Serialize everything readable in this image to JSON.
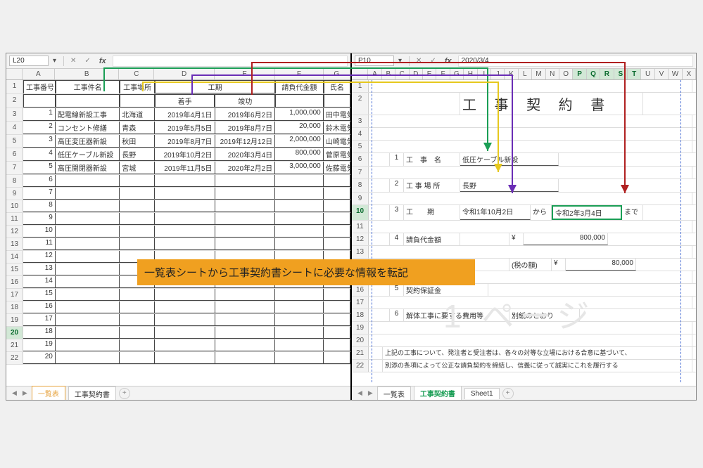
{
  "left": {
    "nameBox": "L20",
    "formulaValue": "",
    "cols": [
      "A",
      "B",
      "C",
      "D",
      "E",
      "F",
      "G"
    ],
    "headers": {
      "no": "工事番号",
      "name": "工事件名",
      "place": "工事場所",
      "period": "工期",
      "start": "着手",
      "end": "竣功",
      "amount": "請負代金額",
      "person": "氏名"
    },
    "rows": [
      {
        "no": "1",
        "name": "配電線新設工事",
        "place": "北海道",
        "start": "2019年4月1日",
        "end": "2019年6月2日",
        "amount": "1,000,000",
        "person": "田中電気管"
      },
      {
        "no": "2",
        "name": "コンセント修繕",
        "place": "青森",
        "start": "2019年5月5日",
        "end": "2019年8月7日",
        "amount": "20,000",
        "person": "鈴木電気管"
      },
      {
        "no": "3",
        "name": "高圧変圧器新設",
        "place": "秋田",
        "start": "2019年8月7日",
        "end": "2019年12月12日",
        "amount": "2,000,000",
        "person": "山崎電気管"
      },
      {
        "no": "4",
        "name": "低圧ケーブル新設",
        "place": "長野",
        "start": "2019年10月2日",
        "end": "2020年3月4日",
        "amount": "800,000",
        "person": "菅原電気管"
      },
      {
        "no": "5",
        "name": "高圧開閉器新設",
        "place": "宮城",
        "start": "2019年11月5日",
        "end": "2020年2月2日",
        "amount": "3,000,000",
        "person": "佐藤電気管"
      }
    ],
    "emptyRows": 15,
    "tabs": [
      "一覧表",
      "工事契約書"
    ],
    "activeTab": "一覧表"
  },
  "right": {
    "nameBox": "P10",
    "formulaValue": "2020/3/4",
    "cols": [
      "A",
      "B",
      "C",
      "D",
      "E",
      "F",
      "G",
      "H",
      "I",
      "J",
      "K",
      "L",
      "M",
      "N",
      "O",
      "P",
      "Q",
      "R",
      "S",
      "T",
      "U",
      "V",
      "W",
      "X"
    ],
    "selCols": [
      "P",
      "Q",
      "R",
      "S",
      "T"
    ],
    "title": "工 事 契 約 書",
    "lines": {
      "l1_no": "1",
      "l1_lbl": "工　事　名",
      "l1_val": "低圧ケーブル新設",
      "l2_no": "2",
      "l2_lbl": "工 事 場 所",
      "l2_val": "長野",
      "l3_no": "3",
      "l3_lbl": "工　　期",
      "l3_from": "令和1年10月2日",
      "l3_kara": "から",
      "l3_to": "令和2年3月4日",
      "l3_made": "まで",
      "l4_no": "4",
      "l4_lbl": "請負代金額",
      "l4_yen": "¥",
      "l4_val": "800,000",
      "l4b_lbl": "(税の額)",
      "l4b_yen": "¥",
      "l4b_val": "80,000",
      "l5_no": "5",
      "l5_lbl": "契約保証金",
      "l6_no": "6",
      "l6_lbl": "解体工事に要する費用等",
      "l6_val": "別紙のとおり"
    },
    "watermark": "1 ページ",
    "footer1": "上記の工事について、発注者と受注者は、各々の対等な立場における合意に基づいて、",
    "footer2": "別添の条項によって公正な請負契約を締結し、信義に従って誠実にこれを履行する",
    "tabs": [
      "一覧表",
      "工事契約書",
      "Sheet1"
    ],
    "activeTab": "工事契約書"
  },
  "callout": "一覧表シートから工事契約書シートに必要な情報を転記",
  "icons": {
    "x": "✕",
    "check": "✓",
    "dd": "▾",
    "nav_l": "◀",
    "nav_r": "▶",
    "plus": "+"
  }
}
